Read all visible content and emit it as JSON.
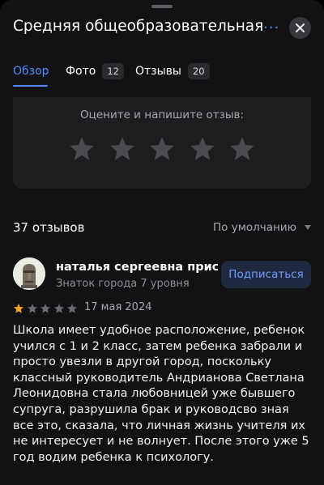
{
  "header": {
    "title": "Средняя общеобразовательная",
    "more": "...",
    "close_icon": "close-icon"
  },
  "tabs": [
    {
      "label": "Обзор",
      "count": null,
      "active": true
    },
    {
      "label": "Фото",
      "count": "12",
      "active": false
    },
    {
      "label": "Отзывы",
      "count": "20",
      "active": false
    }
  ],
  "rate": {
    "prompt": "Оцените и напишите отзыв:",
    "stars": 5
  },
  "reviews": {
    "count_label": "37 отзывов",
    "sort_label": "По умолчанию"
  },
  "review": {
    "author": "наталья сергеевна прис...",
    "level": "Знаток города 7 уровня",
    "subscribe_label": "Подписаться",
    "rating": 1,
    "max_rating": 5,
    "date": "17 мая 2024",
    "text": "Школа имеет удобное расположение, ребенок учился с 1 и 2 класс, затем ребенка забрали и просто увезли в другой город, поскольку классный руководитель Андрианова Светлана Леонидовна стала любовницей уже бывшего супруга, разрушила брак и руководсво зная все это, сказала, что личная жизнь учителя их не интересует и не волнует. После этого уже 5 год водим ребенка к психологу."
  },
  "colors": {
    "accent": "#4f8cff",
    "star_filled": "#f5a623",
    "star_empty": "#6b6b70",
    "star_big": "#4a4a4f"
  }
}
